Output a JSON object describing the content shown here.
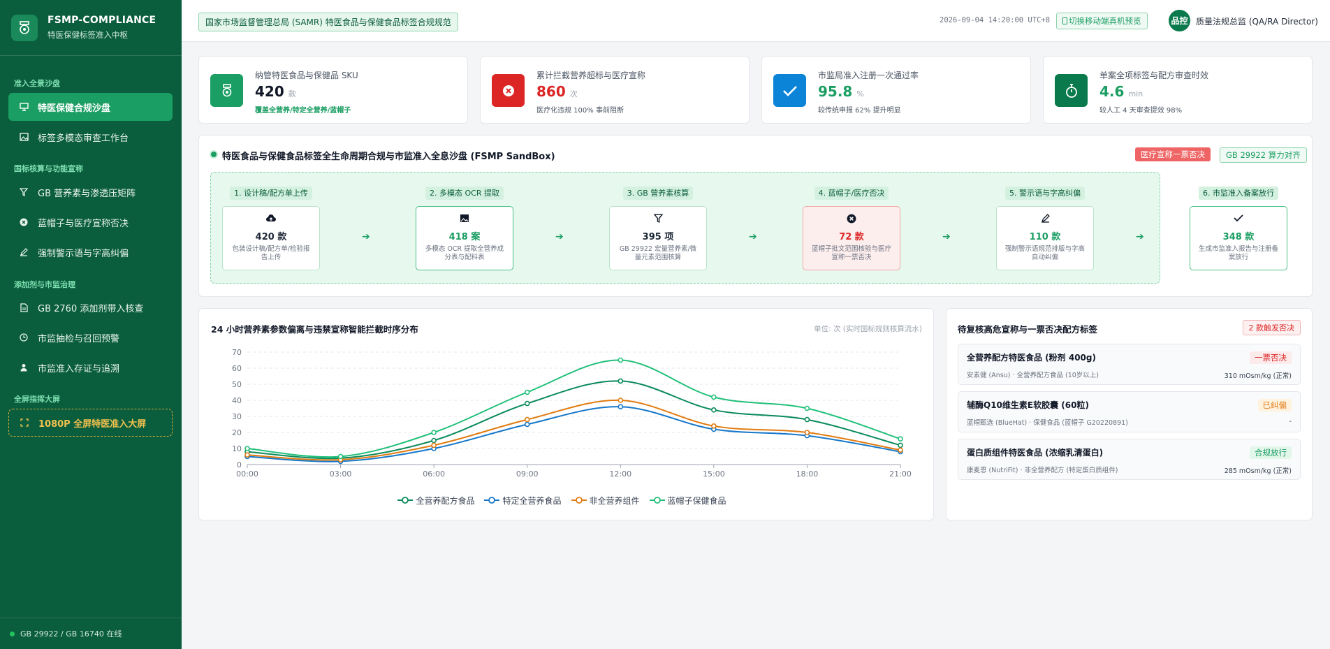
{
  "brand": {
    "name": "FSMP-COMPLIANCE",
    "sub": "特医保健标签准入中枢"
  },
  "sidebar": {
    "groups": [
      "准入全景沙盘",
      "国标核算与功能宣称",
      "添加剂与市监治理",
      "全屏指挥大屏"
    ],
    "items": [
      {
        "label": "特医保健合规沙盘",
        "icon": "monitor-icon"
      },
      {
        "label": "标签多模态审查工作台",
        "icon": "image-icon"
      },
      {
        "label": "GB 营养素与渗透压矩阵",
        "icon": "filter-icon"
      },
      {
        "label": "蓝帽子与医疗宣称否决",
        "icon": "x-circle-icon"
      },
      {
        "label": "强制警示语与字高纠偏",
        "icon": "pencil-icon"
      },
      {
        "label": "GB 2760 添加剂带入核查",
        "icon": "file-icon"
      },
      {
        "label": "市监抽检与召回预警",
        "icon": "clock-icon"
      },
      {
        "label": "市监准入存证与追溯",
        "icon": "user-icon"
      },
      {
        "label": "1080P 全屏特医准入大屏",
        "icon": "fullscreen-icon"
      }
    ],
    "footer": "GB 29922 / GB 16740 在线"
  },
  "header": {
    "title": "国家市场监督管理总局 (SAMR) 特医食品与保健食品标签合规规范",
    "time": "2026-09-04 14:20:00 UTC+8",
    "mobile_label": "切换移动端真机预览",
    "avatar": "品控",
    "user": "质量法规总监 (QA/RA Director)"
  },
  "kpis": [
    {
      "label": "纳管特医食品与保健品 SKU",
      "value": "420",
      "unit": "款",
      "note": "覆盖全营养/特定全营养/蓝帽子",
      "color": "#1b9e63"
    },
    {
      "label": "累计拦截营养超标与医疗宣称",
      "value": "860",
      "unit": "次",
      "note": "医疗化违规 100% 事前阻断",
      "color": "#dc2626"
    },
    {
      "label": "市监局准入注册一次通过率",
      "value": "95.8",
      "unit": "%",
      "note": "较传统申报 62% 提升明显",
      "color": "#0b84d8"
    },
    {
      "label": "单案全项标签与配方审查时效",
      "value": "4.6",
      "unit": "min",
      "note": "较人工 4 天审查提效 98%",
      "color": "#0a7a4d"
    }
  ],
  "pipeline": {
    "title": "特医食品与保健食品标签全生命周期合规与市监准入全息沙盘 (FSMP SandBox)",
    "tag_red": "医疗宣称一票否决",
    "tag_green": "GB 29922 算力对齐",
    "steps": [
      {
        "label": "1. 设计稿/配方单上传",
        "value": "420 款",
        "desc": "包装设计稿/配方单/检验报告上传",
        "icon": "upload-cloud-icon"
      },
      {
        "label": "2. 多模态 OCR 提取",
        "value": "418 案",
        "desc": "多模态 OCR 提取全营养成分表与配料表",
        "icon": "image-icon"
      },
      {
        "label": "3. GB 营养素核算",
        "value": "395 项",
        "desc": "GB 29922 宏量营养素/微量元素范围核算",
        "icon": "filter-icon"
      },
      {
        "label": "4. 蓝帽子/医疗否决",
        "value": "72 款",
        "desc": "蓝帽子批文范围核验与医疗宣称一票否决",
        "icon": "x-circle-icon"
      },
      {
        "label": "5. 警示语与字高纠偏",
        "value": "110 款",
        "desc": "强制警示语规范排版与字高自动纠偏",
        "icon": "pencil-icon"
      },
      {
        "label": "6. 市监准入备案放行",
        "value": "348 款",
        "desc": "生成市监准入报告与注册备案放行",
        "icon": "check-icon"
      }
    ]
  },
  "chart_panel": {
    "title": "24 小时营养素参数偏离与违禁宣称智能拦截时序分布",
    "unit": "单位: 次 (实时国标规则核算流水)"
  },
  "chart_data": {
    "type": "line",
    "x": [
      "00:00",
      "03:00",
      "06:00",
      "09:00",
      "12:00",
      "15:00",
      "18:00",
      "21:00"
    ],
    "ylim": [
      0,
      70
    ],
    "yticks": [
      0,
      10,
      20,
      30,
      40,
      50,
      60,
      70
    ],
    "series": [
      {
        "name": "全营养配方食品",
        "color": "#0a8a5a",
        "values": [
          8,
          4,
          15,
          38,
          52,
          34,
          28,
          12
        ]
      },
      {
        "name": "特定全营养食品",
        "color": "#1677c9",
        "values": [
          5,
          2,
          10,
          25,
          36,
          22,
          18,
          8
        ]
      },
      {
        "name": "非全营养组件",
        "color": "#e07b10",
        "values": [
          6,
          3,
          12,
          28,
          40,
          24,
          20,
          9
        ]
      },
      {
        "name": "蓝帽子保健食品",
        "color": "#21c07a",
        "values": [
          10,
          5,
          20,
          45,
          65,
          42,
          35,
          16
        ]
      }
    ]
  },
  "queue": {
    "title": "待复核高危宣称与一票否决配方标签",
    "badge": "2 款触发否决",
    "items": [
      {
        "name": "全营养配方特医食品 (粉剂 400g)",
        "meta": "安素健 (Ansu) · 全营养配方食品 (10岁以上)",
        "status": "一票否决",
        "value": "310 mOsm/kg (正常)",
        "status_bg": "#fdeaea",
        "status_fg": "#dc2626"
      },
      {
        "name": "辅酶Q10维生素E软胶囊 (60粒)",
        "meta": "蓝帽甄选 (BlueHat) · 保健食品 (蓝帽子 G20220891)",
        "status": "已纠偏",
        "value": "-",
        "status_bg": "#fff3e0",
        "status_fg": "#e07b10"
      },
      {
        "name": "蛋白质组件特医食品 (浓缩乳清蛋白)",
        "meta": "康麦恩 (NutriFit) · 非全营养配方 (特定蛋白质组件)",
        "status": "合规放行",
        "value": "285 mOsm/kg (正常)",
        "status_bg": "#e3f6ea",
        "status_fg": "#1b9e63"
      }
    ]
  }
}
